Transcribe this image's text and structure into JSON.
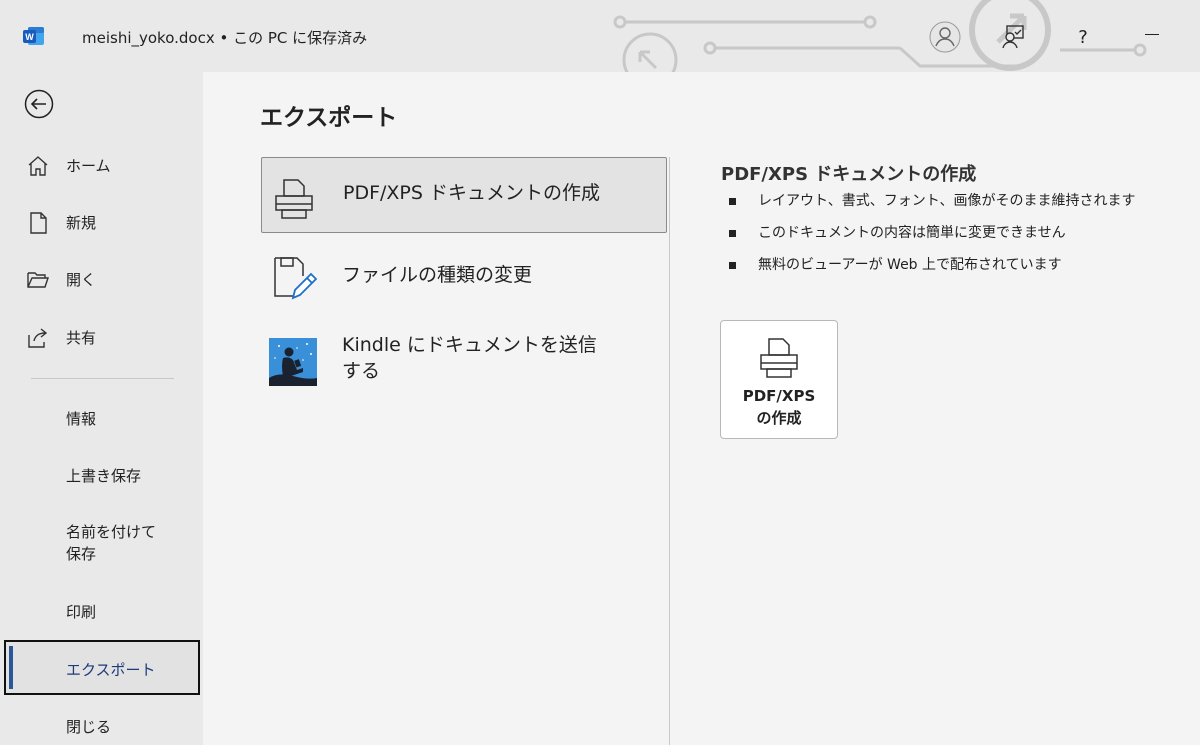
{
  "app": {
    "logo_icon": "word-logo-icon",
    "document_title": "meishi_yoko.docx • この PC に保存済み",
    "help_label": "?",
    "accent_color": "#2b579a"
  },
  "sidebar": {
    "items": [
      {
        "label": "ホーム",
        "icon": "home-icon"
      },
      {
        "label": "新規",
        "icon": "new-document-icon"
      },
      {
        "label": "開く",
        "icon": "open-folder-icon"
      },
      {
        "label": "共有",
        "icon": "share-icon"
      }
    ],
    "secondary": [
      {
        "label": "情報"
      },
      {
        "label": "上書き保存"
      },
      {
        "label": "名前を付けて\n保存"
      },
      {
        "label": "印刷"
      },
      {
        "label": "エクスポート",
        "selected": true
      },
      {
        "label": "閉じる"
      }
    ]
  },
  "main": {
    "title": "エクスポート",
    "options": [
      {
        "label": "PDF/XPS ドキュメントの作成",
        "icon": "printer-icon",
        "selected": true
      },
      {
        "label": "ファイルの種類の変更",
        "icon": "file-edit-icon"
      },
      {
        "label": "Kindle にドキュメントを送信\nする",
        "icon": "kindle-icon"
      }
    ],
    "detail": {
      "title": "PDF/XPS ドキュメントの作成",
      "bullets": [
        "レイアウト、書式、フォント、画像がそのまま維持されます",
        "このドキュメントの内容は簡単に変更できません",
        "無料のビューアーが Web 上で配布されています"
      ],
      "button_label": "PDF/XPS\nの作成"
    }
  }
}
